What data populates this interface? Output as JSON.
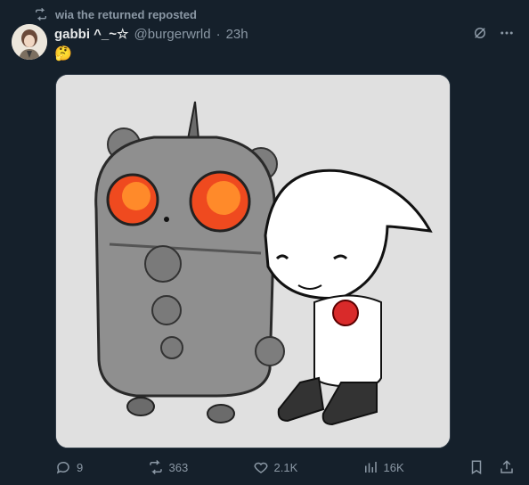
{
  "repost": {
    "text": "wia the returned reposted",
    "icon": "repost-icon"
  },
  "author": {
    "name": "gabbi ^_~☆",
    "handle": "@burgerwrld",
    "separator": "·",
    "time": "23h"
  },
  "tweet": {
    "text": "🤔"
  },
  "top_actions": [
    "grok-icon",
    "more-icon"
  ],
  "actions": {
    "replies": "9",
    "reposts": "363",
    "likes": "2.1K",
    "views": "16K"
  },
  "colors": {
    "background": "#15202b",
    "secondary_text": "#8b98a5",
    "primary_text": "#e7e9ea",
    "media_bg": "#e0e0e0"
  }
}
